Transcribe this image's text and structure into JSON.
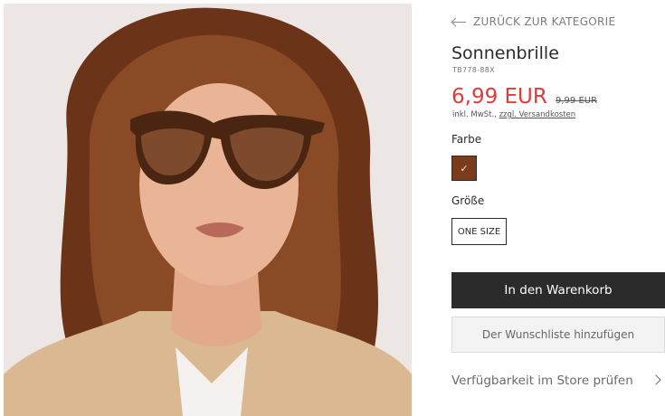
{
  "product_image": {
    "alt": "Woman with curly hair wearing tortoiseshell sunglasses"
  },
  "nav": {
    "back_label": "ZURÜCK ZUR KATEGORIE"
  },
  "product": {
    "title": "Sonnenbrille",
    "sku": "TB778-88X",
    "price": "6,99 EUR",
    "old_price": "9,99 EUR",
    "tax_prefix": "inkl. MwSt.,",
    "shipping_link": "zzgl. Versandkosten"
  },
  "options": {
    "color_label": "Farbe",
    "color_swatch": "#7b3c1c",
    "color_check": "✓",
    "size_label": "Größe",
    "size_value": "ONE SIZE"
  },
  "actions": {
    "add_to_cart": "In den Warenkorb",
    "add_to_wishlist": "Der Wunschliste hinzufügen",
    "store_availability": "Verfügbarkeit im Store prüfen"
  }
}
